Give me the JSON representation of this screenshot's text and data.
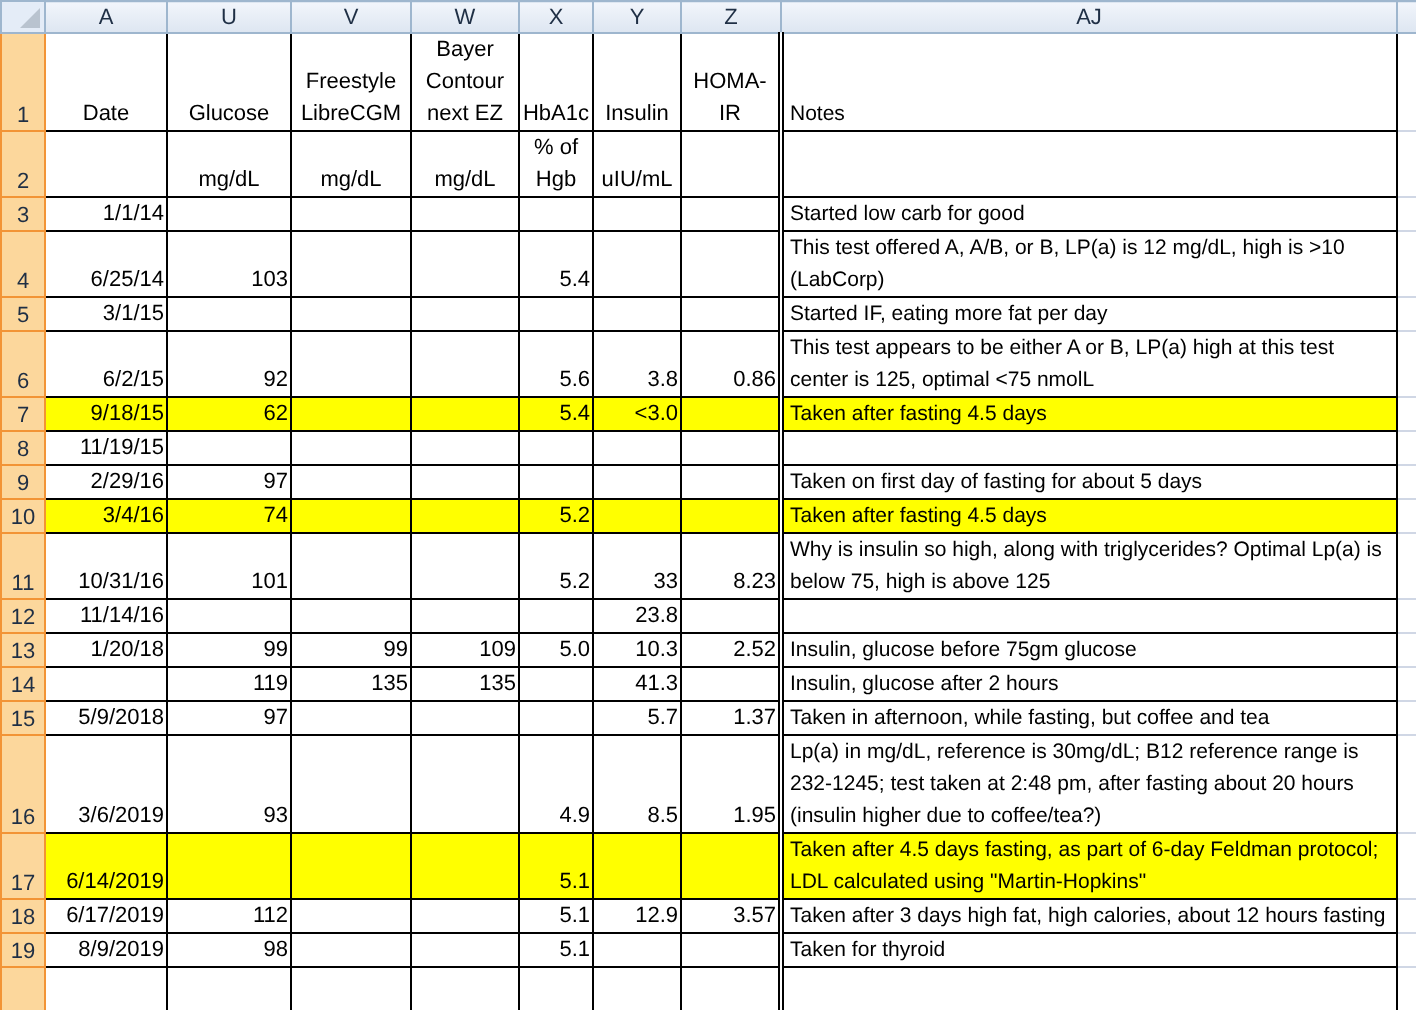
{
  "columns": [
    "A",
    "U",
    "V",
    "W",
    "X",
    "Y",
    "Z",
    "AJ"
  ],
  "rows": [
    {
      "number": "1",
      "kind": "header",
      "highlighted": false,
      "cells": [
        "Date",
        "Glucose",
        "Freestyle LibreCGM",
        "Bayer Contour next  EZ",
        "HbA1c",
        "Insulin",
        "HOMA-IR",
        "Notes"
      ]
    },
    {
      "number": "2",
      "kind": "header",
      "highlighted": false,
      "cells": [
        null,
        "mg/dL",
        "mg/dL",
        "mg/dL",
        "% of Hgb",
        "uIU/mL",
        null,
        null
      ]
    },
    {
      "number": "3",
      "kind": "data",
      "highlighted": false,
      "cells": [
        "1/1/14",
        null,
        null,
        null,
        null,
        null,
        null,
        "Started low carb for good"
      ]
    },
    {
      "number": "4",
      "kind": "data",
      "highlighted": false,
      "cells": [
        "6/25/14",
        "103",
        null,
        null,
        "5.4",
        null,
        null,
        "This test offered A, A/B, or B, LP(a) is 12 mg/dL, high is >10 (LabCorp)"
      ]
    },
    {
      "number": "5",
      "kind": "data",
      "highlighted": false,
      "cells": [
        "3/1/15",
        null,
        null,
        null,
        null,
        null,
        null,
        "Started IF, eating more fat per day"
      ]
    },
    {
      "number": "6",
      "kind": "data",
      "highlighted": false,
      "cells": [
        "6/2/15",
        "92",
        null,
        null,
        "5.6",
        "3.8",
        "0.86",
        "This test appears to be either A or B, LP(a) high at this test center is 125, optimal <75 nmolL"
      ]
    },
    {
      "number": "7",
      "kind": "data",
      "highlighted": true,
      "cells": [
        "9/18/15",
        "62",
        null,
        null,
        "5.4",
        "<3.0",
        null,
        "Taken after fasting 4.5 days"
      ]
    },
    {
      "number": "8",
      "kind": "data",
      "highlighted": false,
      "cells": [
        "11/19/15",
        null,
        null,
        null,
        null,
        null,
        null,
        null
      ]
    },
    {
      "number": "9",
      "kind": "data",
      "highlighted": false,
      "cells": [
        "2/29/16",
        "97",
        null,
        null,
        null,
        null,
        null,
        "Taken on first day of fasting for about 5 days"
      ]
    },
    {
      "number": "10",
      "kind": "data",
      "highlighted": true,
      "cells": [
        "3/4/16",
        "74",
        null,
        null,
        "5.2",
        null,
        null,
        "Taken after fasting 4.5 days"
      ]
    },
    {
      "number": "11",
      "kind": "data",
      "highlighted": false,
      "cells": [
        "10/31/16",
        "101",
        null,
        null,
        "5.2",
        "33",
        "8.23",
        "Why is insulin so high, along with triglycerides? Optimal Lp(a) is below 75, high is above 125"
      ]
    },
    {
      "number": "12",
      "kind": "data",
      "highlighted": false,
      "cells": [
        "11/14/16",
        null,
        null,
        null,
        null,
        "23.8",
        null,
        null
      ]
    },
    {
      "number": "13",
      "kind": "data",
      "highlighted": false,
      "cells": [
        "1/20/18",
        "99",
        "99",
        "109",
        "5.0",
        "10.3",
        "2.52",
        "Insulin, glucose before 75gm glucose"
      ]
    },
    {
      "number": "14",
      "kind": "data",
      "highlighted": false,
      "cells": [
        null,
        "119",
        "135",
        "135",
        null,
        "41.3",
        null,
        "Insulin, glucose after 2 hours"
      ]
    },
    {
      "number": "15",
      "kind": "data",
      "highlighted": false,
      "cells": [
        "5/9/2018",
        "97",
        null,
        null,
        null,
        "5.7",
        "1.37",
        "Taken in afternoon, while fasting, but coffee and tea"
      ]
    },
    {
      "number": "16",
      "kind": "data",
      "highlighted": false,
      "cells": [
        "3/6/2019",
        "93",
        null,
        null,
        "4.9",
        "8.5",
        "1.95",
        "Lp(a) in mg/dL, reference is 30mg/dL; B12 reference range is 232-1245; test taken at 2:48 pm, after fasting about 20 hours (insulin higher due to coffee/tea?)"
      ]
    },
    {
      "number": "17",
      "kind": "data",
      "highlighted": true,
      "cells": [
        "6/14/2019",
        null,
        null,
        null,
        "5.1",
        null,
        null,
        "Taken after 4.5 days fasting, as part of 6-day Feldman protocol; LDL calculated using \"Martin-Hopkins\""
      ]
    },
    {
      "number": "18",
      "kind": "data",
      "highlighted": false,
      "cells": [
        "6/17/2019",
        "112",
        null,
        null,
        "5.1",
        "12.9",
        "3.57",
        "Taken after 3 days high fat, high calories, about 12 hours fasting"
      ]
    },
    {
      "number": "19",
      "kind": "data",
      "highlighted": false,
      "cells": [
        "8/9/2019",
        "98",
        null,
        null,
        "5.1",
        null,
        null,
        "Taken for thyroid"
      ]
    }
  ]
}
